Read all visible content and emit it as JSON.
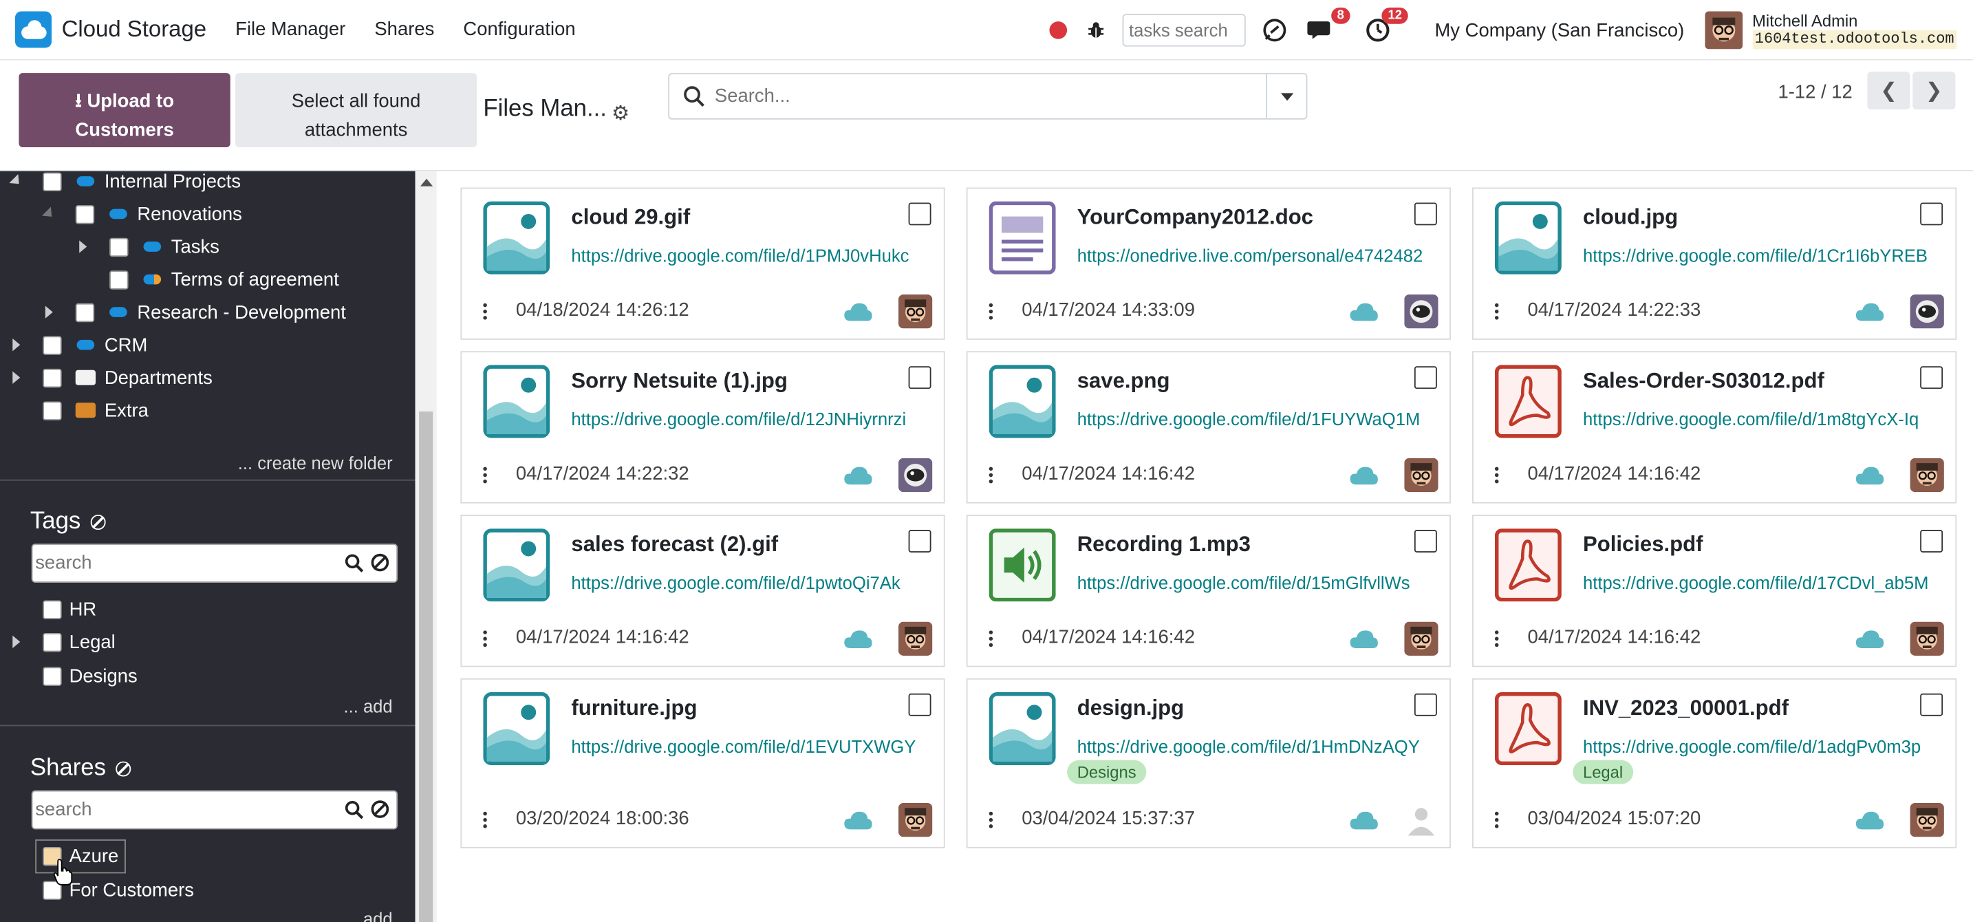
{
  "app": {
    "name": "Cloud Storage",
    "menu": [
      "File Manager",
      "Shares",
      "Configuration"
    ]
  },
  "navbar": {
    "tasks_search_placeholder": "tasks search",
    "messages_count": "8",
    "activities_count": "12",
    "company": "My Company (San Francisco)",
    "user_name": "Mitchell Admin",
    "user_db": "1604test.odootools.com"
  },
  "control": {
    "upload_label_line1": "Upload to",
    "upload_label_line2": "Customers",
    "select_label_line1": "Select all found",
    "select_label_line2": "attachments",
    "breadcrumb": "Files Man...",
    "search_placeholder": "Search...",
    "pager": "1-12 / 12"
  },
  "sidebar": {
    "folders": [
      {
        "label": "Internal Projects",
        "icon": "cloud-blue"
      },
      {
        "label": "Renovations",
        "icon": "cloud-blue"
      },
      {
        "label": "Tasks",
        "icon": "cloud-blue"
      },
      {
        "label": "Terms of agreement",
        "icon": "cloud-blue-orange"
      },
      {
        "label": "Research - Development",
        "icon": "cloud-blue"
      },
      {
        "label": "CRM",
        "icon": "cloud-blue"
      },
      {
        "label": "Departments",
        "icon": "folder-white"
      },
      {
        "label": "Extra",
        "icon": "folder-orange"
      }
    ],
    "create_folder": "... create new folder",
    "tags_title": "Tags",
    "tags_search_placeholder": "search",
    "tags": [
      "HR",
      "Legal",
      "Designs"
    ],
    "tags_add": "... add",
    "shares_title": "Shares",
    "shares_search_placeholder": "search",
    "shares": [
      "Azure",
      "For Customers"
    ],
    "shares_add": "... add"
  },
  "files": [
    {
      "name": "cloud 29.gif",
      "url": "https://drive.google.com/file/d/1PMJ0vHukc",
      "date": "04/18/2024 14:26:12",
      "type": "image",
      "avatar": "mitchell"
    },
    {
      "name": "YourCompany2012.doc",
      "url": "https://onedrive.live.com/personal/e4742482",
      "date": "04/17/2024 14:33:09",
      "type": "document",
      "avatar": "robot"
    },
    {
      "name": "cloud.jpg",
      "url": "https://drive.google.com/file/d/1Cr1I6bYREB",
      "date": "04/17/2024 14:22:33",
      "type": "image",
      "avatar": "robot"
    },
    {
      "name": "Sorry Netsuite (1).jpg",
      "url": "https://drive.google.com/file/d/12JNHiyrnrzi",
      "date": "04/17/2024 14:22:32",
      "type": "image",
      "avatar": "robot"
    },
    {
      "name": "save.png",
      "url": "https://drive.google.com/file/d/1FUYWaQ1M",
      "date": "04/17/2024 14:16:42",
      "type": "image",
      "avatar": "mitchell"
    },
    {
      "name": "Sales-Order-S03012.pdf",
      "url": "https://drive.google.com/file/d/1m8tgYcX-Iq",
      "date": "04/17/2024 14:16:42",
      "type": "pdf",
      "avatar": "mitchell"
    },
    {
      "name": "sales forecast (2).gif",
      "url": "https://drive.google.com/file/d/1pwtoQi7Ak",
      "date": "04/17/2024 14:16:42",
      "type": "image",
      "avatar": "mitchell"
    },
    {
      "name": "Recording 1.mp3",
      "url": "https://drive.google.com/file/d/15mGlfvllWs",
      "date": "04/17/2024 14:16:42",
      "type": "audio",
      "avatar": "mitchell"
    },
    {
      "name": "Policies.pdf",
      "url": "https://drive.google.com/file/d/17CDvl_ab5M",
      "date": "04/17/2024 14:16:42",
      "type": "pdf",
      "avatar": "mitchell"
    },
    {
      "name": "furniture.jpg",
      "url": "https://drive.google.com/file/d/1EVUTXWGY",
      "date": "03/20/2024 18:00:36",
      "type": "image",
      "avatar": "mitchell"
    },
    {
      "name": "design.jpg",
      "url": "https://drive.google.com/file/d/1HmDNzAQY",
      "date": "03/04/2024 15:37:37",
      "type": "image",
      "avatar": "placeholder",
      "tag": "Designs"
    },
    {
      "name": "INV_2023_00001.pdf",
      "url": "https://drive.google.com/file/d/1adgPv0m3p",
      "date": "03/04/2024 15:07:20",
      "type": "pdf",
      "avatar": "mitchell",
      "tag": "Legal"
    }
  ],
  "colors": {
    "primary": "#714b67",
    "link": "#017e84",
    "sidebar_bg": "#2b2b33",
    "badge": "#d9363e",
    "cloud_teal": "#5bb7c4",
    "tag_green": "#bfe8c1"
  }
}
